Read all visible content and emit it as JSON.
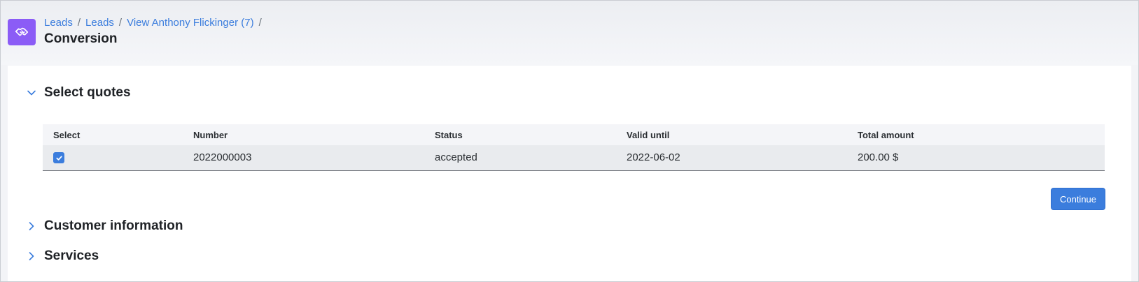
{
  "header": {
    "app_icon": "handshake-icon",
    "accent_color": "#8b5cf6",
    "breadcrumb": [
      {
        "label": "Leads"
      },
      {
        "label": "Leads"
      },
      {
        "label": "View Anthony Flickinger (7)"
      }
    ],
    "title": "Conversion"
  },
  "sections": {
    "select_quotes": {
      "title": "Select quotes",
      "expanded": true
    },
    "customer_information": {
      "title": "Customer information",
      "expanded": false
    },
    "services": {
      "title": "Services",
      "expanded": false
    }
  },
  "quotes_table": {
    "columns": [
      "Select",
      "Number",
      "Status",
      "Valid until",
      "Total amount"
    ],
    "rows": [
      {
        "selected": true,
        "number": "2022000003",
        "status": "accepted",
        "valid_until": "2022-06-02",
        "total_amount": "200.00 $"
      }
    ]
  },
  "actions": {
    "continue_label": "Continue",
    "primary_color": "#3b7ddd"
  }
}
